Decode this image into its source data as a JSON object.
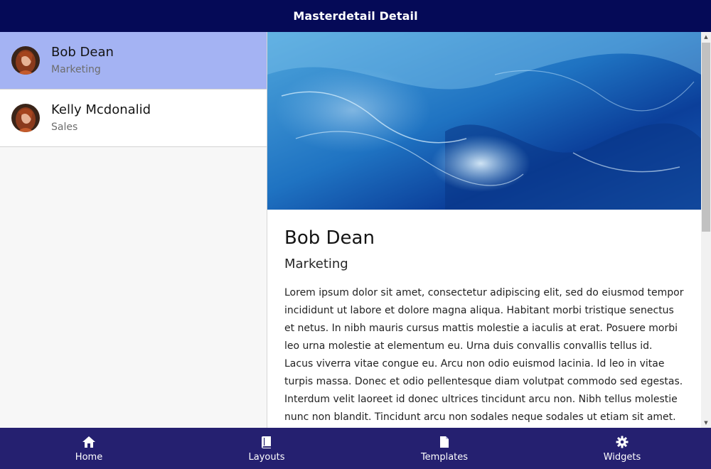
{
  "header": {
    "title": "Masterdetail Detail"
  },
  "master": {
    "items": [
      {
        "name": "Bob Dean",
        "department": "Marketing",
        "selected": true
      },
      {
        "name": "Kelly Mcdonalid",
        "department": "Sales",
        "selected": false
      }
    ]
  },
  "detail": {
    "name": "Bob Dean",
    "department": "Marketing",
    "description": "Lorem ipsum dolor sit amet, consectetur adipiscing elit, sed do eiusmod tempor incididunt ut labore et dolore magna aliqua. Habitant morbi tristique senectus et netus. In nibh mauris cursus mattis molestie a iaculis at erat. Posuere morbi leo urna molestie at elementum eu. Urna duis convallis convallis tellus id. Lacus viverra vitae congue eu. Arcu non odio euismod lacinia. Id leo in vitae turpis massa. Donec et odio pellentesque diam volutpat commodo sed egestas. Interdum velit laoreet id donec ultrices tincidunt arcu non. Nibh tellus molestie nunc non blandit. Tincidunt arcu non sodales neque sodales ut etiam sit amet. Facilisis mauris sit"
  },
  "bottom_nav": {
    "items": [
      {
        "label": "Home",
        "icon": "home-icon"
      },
      {
        "label": "Layouts",
        "icon": "book-icon"
      },
      {
        "label": "Templates",
        "icon": "document-icon"
      },
      {
        "label": "Widgets",
        "icon": "gear-icon"
      }
    ]
  },
  "colors": {
    "topbar": "#050a57",
    "bottom_nav": "#252070",
    "selected_item": "#a4b3f3"
  }
}
